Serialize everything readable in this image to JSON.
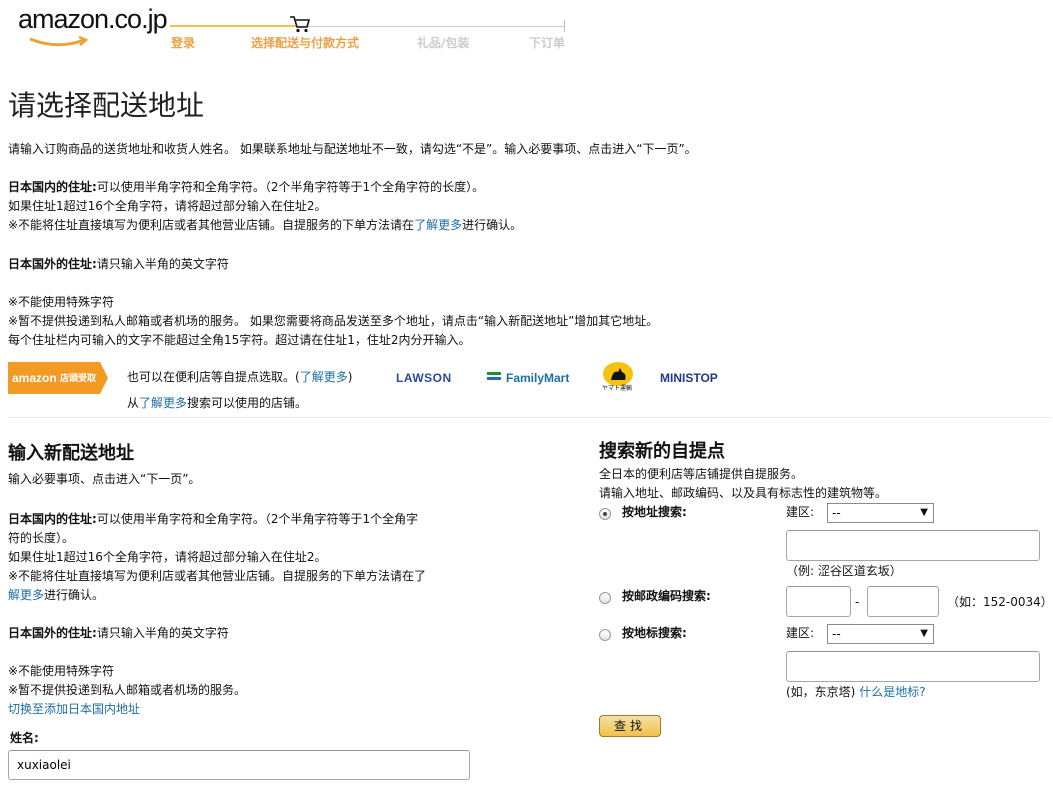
{
  "header": {
    "logo_text": "amazon.co.jp",
    "steps": [
      "登录",
      "选择配送与付款方式",
      "礼品/包装",
      "下订单"
    ],
    "active_step": 1
  },
  "page_title": "请选择配送地址",
  "intro": "请输入订购商品的送货地址和收货人姓名。 如果联系地址与配送地址不一致，请勾选“不是”。输入必要事项、点击进入“下一页”。",
  "domestic": {
    "label": "日本国内的住址:",
    "rule": "可以使用半角字符和全角字符。（2个半角字符等于1个全角字符的长度）。",
    "line2": "如果住址1超过16个全角字符，请将超过部分输入在住址2。",
    "line3_pre": "※不能将住址直接填写为便利店或者其他营业店铺。自提服务的下单方法请在",
    "line3_link": "了解更多",
    "line3_post": "进行确认。"
  },
  "overseas": {
    "label": "日本国外的住址:",
    "rule": "请只输入半角的英文字符"
  },
  "notes": [
    "※不能使用特殊字符",
    "※暂不提供投递到私人邮箱或者机场的服务。 如果您需要将商品发送至多个地址，请点击“输入新配送地址”增加其它地址。",
    "每个住址栏内可输入的文字不能超过全角15字符。超过请在住址1，住址2内分开输入。"
  ],
  "pickup": {
    "badge_brand": "amazon",
    "badge_text": "店頭受取",
    "line1_pre": "也可以在便利店等自提点选取。(",
    "line1_link": "了解更多",
    "line1_post": ")",
    "line2_pre": "从",
    "line2_link": "了解更多",
    "line2_post": "搜索可以使用的店铺。",
    "stores": [
      "LAWSON",
      "FamilyMart",
      "ヤマト運輸",
      "MINISTOP"
    ]
  },
  "new_address": {
    "title": "输入新配送地址",
    "subtitle": "输入必要事项、点击进入“下一页”。",
    "domestic_rule_a": "可以使用半角字符和全角字符。（2个半角字符等于1个全角字",
    "domestic_rule_b": "符的长度）。",
    "line2": "如果住址1超过16个全角字符，请将超过部分输入在住址2。",
    "line3_pre": "※不能将住址直接填写为便利店或者其他营业店铺。自提服务的下单方法请在了",
    "line3_link": "解更多",
    "line3_post": "进行确认。",
    "note1": "※不能使用特殊字符",
    "note2": "※暂不提供投递到私人邮箱或者机场的服务。",
    "switch_link": "切换至添加日本国内地址",
    "name_label": "姓名:",
    "name_value": "xuxiaolei"
  },
  "search_pickup": {
    "title": "搜索新的自提点",
    "desc1": "全日本的便利店等店铺提供自提服务。",
    "desc2": "请输入地址、邮政编码、以及具有标志性的建筑物等。",
    "by_address": "按地址搜索:",
    "by_postal": "按邮政编码搜索:",
    "by_landmark": "按地标搜索:",
    "prefecture_label": "建区:",
    "select_value": "--",
    "address_hint": "（例:  涩谷区道玄坂）",
    "postal_dash": "-",
    "postal_hint": "（如：152-0034）",
    "landmark_hint_pre": "(如，东京塔)",
    "landmark_hint_link": "什么是地标?",
    "search_button": "查找"
  }
}
